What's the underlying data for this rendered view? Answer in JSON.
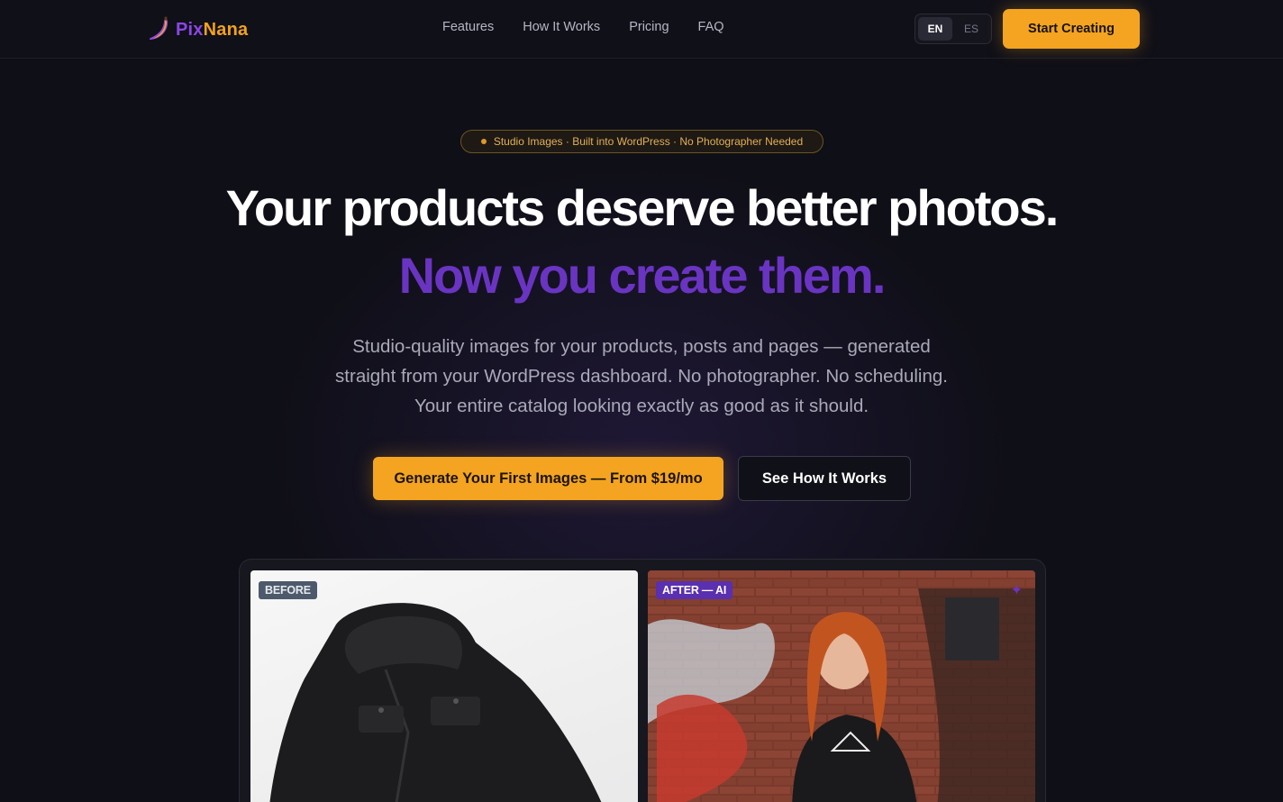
{
  "header": {
    "logo": {
      "part1": "Pix",
      "part2": "Nana",
      "icon": "banana-icon"
    },
    "nav": [
      "Features",
      "How It Works",
      "Pricing",
      "FAQ"
    ],
    "lang": {
      "active": "EN",
      "inactive": "ES"
    },
    "cta": "Start Creating"
  },
  "hero": {
    "badge": "Studio Images · Built into WordPress · No Photographer Needed",
    "title_line1": "Your products deserve better photos.",
    "title_line2": "Now you create them.",
    "subtitle": "Studio-quality images for your products, posts and pages — generated straight from your WordPress dashboard. No photographer. No scheduling. Your entire catalog looking exactly as good as it should.",
    "primary_button": "Generate Your First Images — From $19/mo",
    "secondary_button": "See How It Works"
  },
  "compare": {
    "before_label": "BEFORE",
    "after_label": "AFTER — AI",
    "after_icon": "sparkle-icon"
  },
  "colors": {
    "background": "#0f0f17",
    "accent_orange": "#f4a420",
    "accent_purple": "#6a34c2"
  }
}
